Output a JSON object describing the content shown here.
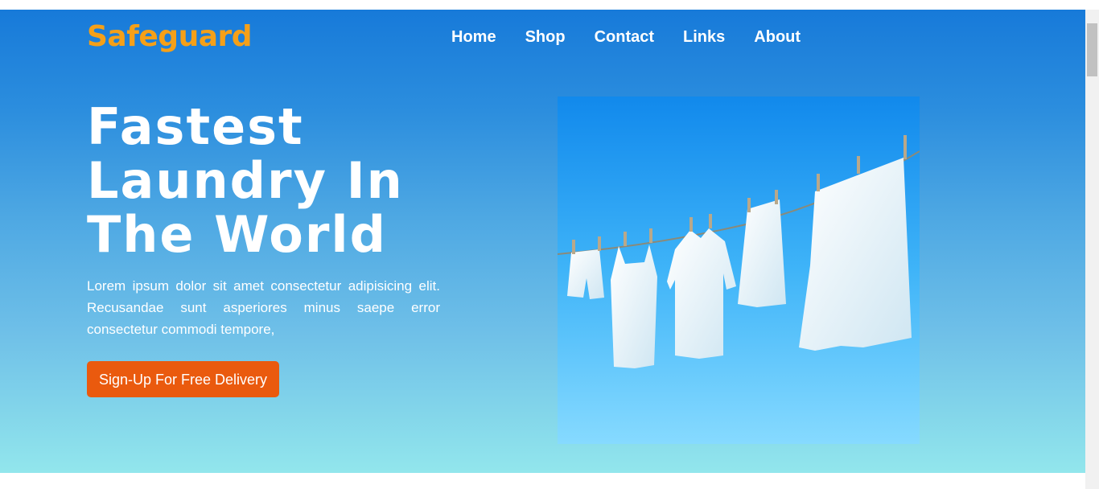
{
  "brand": {
    "name": "Safeguard",
    "color": "#f5a018"
  },
  "nav": {
    "items": [
      "Home",
      "Shop",
      "Contact",
      "Links",
      "About"
    ]
  },
  "hero": {
    "headline_lines": [
      "Fastest",
      "Laundry In",
      "The World"
    ],
    "description": "Lorem ipsum dolor sit amet consectetur adipisicing elit. Recusandae sunt asperiores minus saepe error consectetur commodi tempore,",
    "cta_label": "Sign-Up For Free Delivery",
    "cta_color": "#ea5a0e",
    "image_subject": "clothes-on-clothesline-image"
  }
}
